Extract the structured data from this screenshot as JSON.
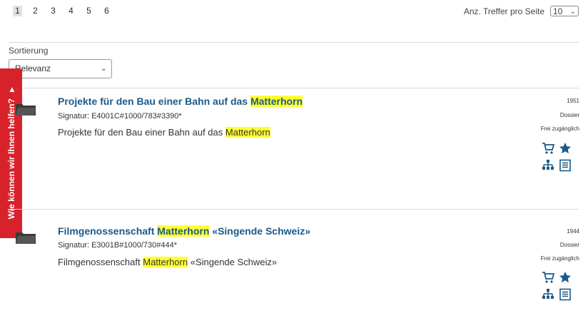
{
  "pagination": {
    "pages": [
      "1",
      "2",
      "3",
      "4",
      "5",
      "6"
    ],
    "active": "1"
  },
  "hits_per_page": {
    "label": "Anz. Treffer pro Seite",
    "value": "10"
  },
  "sort": {
    "label": "Sortierung",
    "value": "Relevanz"
  },
  "feedback_tab": {
    "label": "Wie können wir Ihnen helfen?"
  },
  "colors": {
    "accent": "#1a5a8a",
    "highlight": "#ffff33",
    "feedback": "#d8222b"
  },
  "results": [
    {
      "title_pre": "Projekte für den Bau einer Bahn auf das ",
      "title_hl": "Matterhorn",
      "title_post": "",
      "signature": "Signatur: E4001C#1000/783#3390*",
      "desc_pre": "Projekte für den Bau einer Bahn auf das ",
      "desc_hl": "Matterhorn",
      "desc_post": "",
      "year": "1951",
      "level": "Dossier",
      "access": "Frei zugänglich"
    },
    {
      "title_pre": "Filmgenossenschaft ",
      "title_hl": "Matterhorn",
      "title_post": " «Singende Schweiz»",
      "signature": "Signatur: E3001B#1000/730#444*",
      "desc_pre": "Filmgenossenschaft ",
      "desc_hl": "Matterhorn",
      "desc_post": " «Singende Schweiz»",
      "year": "1944",
      "level": "Dossier",
      "access": "Frei zugänglich"
    }
  ]
}
